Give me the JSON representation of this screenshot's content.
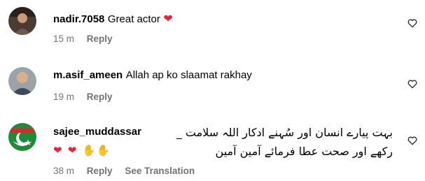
{
  "comments": [
    {
      "username": "nadir.7058",
      "text": "Great actor",
      "emoji": "❤",
      "time": "15 m",
      "reply": "Reply"
    },
    {
      "username": "m.asif_ameen",
      "text": "Allah ap ko slaamat rakhay",
      "time": "19 m",
      "reply": "Reply"
    },
    {
      "username": "sajee_muddassar",
      "urdu_line1": "بہت پیارے انسان اور سُہنے ادکار اللہ سلامت _",
      "urdu_line2": "رکھے اور صحت عطا فرمائے آمین آمین",
      "emojis": "👏👏❤❤",
      "time": "38 m",
      "reply": "Reply",
      "see_translation": "See Translation"
    }
  ],
  "icons": {
    "like": "heart-outline-icon"
  },
  "colors": {
    "heart": "#e8223a",
    "meta": "#737373"
  }
}
